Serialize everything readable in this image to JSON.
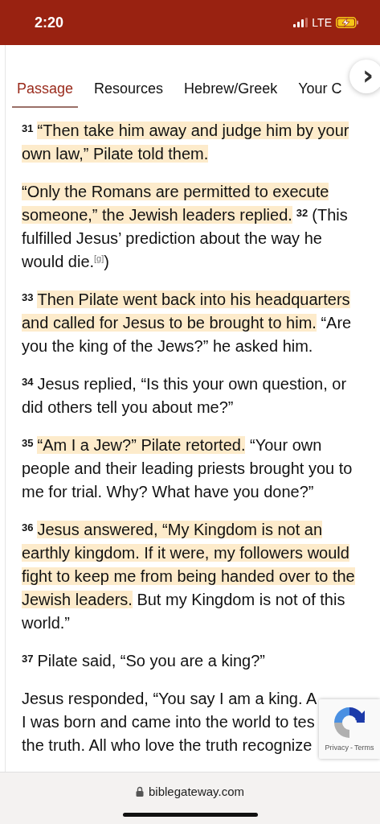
{
  "status_bar": {
    "time": "2:20",
    "network": "LTE"
  },
  "tabs": [
    {
      "label": "Passage",
      "selected": true
    },
    {
      "label": "Resources",
      "selected": false
    },
    {
      "label": "Hebrew/Greek",
      "selected": false
    },
    {
      "label": "Your C",
      "selected": false
    }
  ],
  "tabs_next": "›",
  "paragraphs": [
    {
      "segments": [
        {
          "kind": "verse",
          "text": "31"
        },
        {
          "kind": "text",
          "text": "“Then take him away and judge him by your own law,” Pilate told them.",
          "highlighted": true
        }
      ]
    },
    {
      "segments": [
        {
          "kind": "text",
          "text": "“Only the Romans are permitted to execute someone,” the Jewish leaders replied.",
          "highlighted": true
        },
        {
          "kind": "verse",
          "text": "32"
        },
        {
          "kind": "text",
          "text": "(This fulfilled Jesus’ prediction about the way he would die.",
          "highlighted": false
        },
        {
          "kind": "footnote",
          "text": "[g]"
        },
        {
          "kind": "text",
          "text": ")",
          "highlighted": false
        }
      ]
    },
    {
      "segments": [
        {
          "kind": "verse",
          "text": "33"
        },
        {
          "kind": "text",
          "text": "Then Pilate went back into his headquarters and called for Jesus to be brought to him.",
          "highlighted": true
        },
        {
          "kind": "text",
          "text": " “Are you the king of the Jews?” he asked him.",
          "highlighted": false
        }
      ]
    },
    {
      "segments": [
        {
          "kind": "verse",
          "text": "34"
        },
        {
          "kind": "text",
          "text": "Jesus replied, “Is this your own question, or did others tell you about me?”",
          "highlighted": false
        }
      ]
    },
    {
      "segments": [
        {
          "kind": "verse",
          "text": "35"
        },
        {
          "kind": "text",
          "text": "“Am I a Jew?” Pilate retorted.",
          "highlighted": true
        },
        {
          "kind": "text",
          "text": " “Your own people and their leading priests brought you to me for trial. Why? What have you done?”",
          "highlighted": false
        }
      ]
    },
    {
      "segments": [
        {
          "kind": "verse",
          "text": "36"
        },
        {
          "kind": "text",
          "text": "Jesus answered, “My Kingdom is not an earthly kingdom. If it were, my followers would fight to keep me from being handed over to the Jewish leaders.",
          "highlighted": true
        },
        {
          "kind": "text",
          "text": " But my Kingdom is not of this world.”",
          "highlighted": false
        }
      ]
    },
    {
      "segments": [
        {
          "kind": "verse",
          "text": "37"
        },
        {
          "kind": "text",
          "text": "Pilate said, “So you are a king?”",
          "highlighted": false
        }
      ]
    }
  ],
  "cut_paragraph": {
    "lines": [
      "Jesus responded, “You say I am a king. A",
      "I was born and came into the world to tes",
      "the truth. All who love the truth recognize"
    ]
  },
  "recaptcha": {
    "links": [
      "Privacy",
      "Terms"
    ],
    "separator": "-"
  },
  "address_bar": {
    "url": "biblegateway.com"
  }
}
